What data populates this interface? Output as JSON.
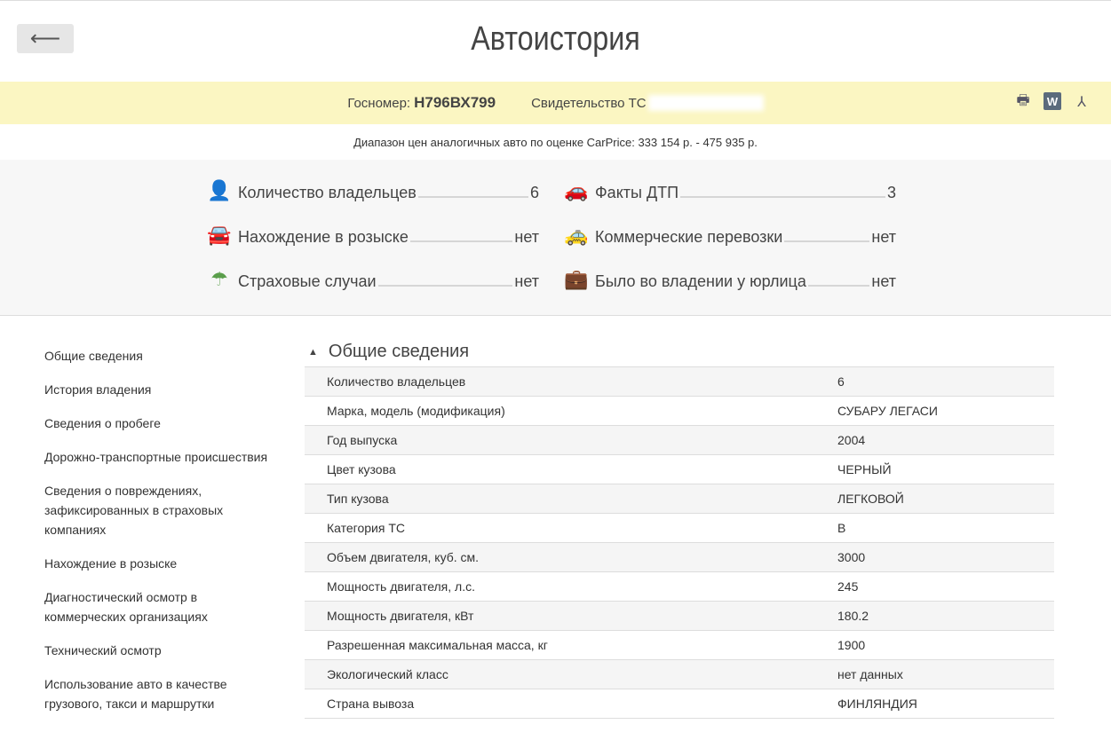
{
  "header": {
    "title": "Автоистория",
    "back_icon": "arrow-left"
  },
  "info": {
    "plate_label": "Госномер:",
    "plate": "Н796ВХ799",
    "cert_label": "Свидетельство ТС"
  },
  "price": "Диапазон цен аналогичных авто по оценке CarPrice: 333 154 р. - 475 935 р.",
  "summary": [
    {
      "label": "Количество владельцев",
      "value": "6",
      "icon": "person-icon"
    },
    {
      "label": "Факты ДТП",
      "value": "3",
      "icon": "crashed-car-icon"
    },
    {
      "label": "Нахождение в розыске",
      "value": "нет",
      "icon": "car-check-icon"
    },
    {
      "label": "Коммерческие перевозки",
      "value": "нет",
      "icon": "taxi-icon"
    },
    {
      "label": "Страховые случаи",
      "value": "нет",
      "icon": "umbrella-icon"
    },
    {
      "label": "Было во владении у юрлица",
      "value": "нет",
      "icon": "person-briefcase-icon"
    }
  ],
  "sidebar": [
    "Общие сведения",
    "История владения",
    "Сведения о пробеге",
    "Дорожно-транспортные происшествия",
    "Сведения о повреждениях, зафиксированных в страховых компаниях",
    "Нахождение в розыске",
    "Диагностический осмотр в коммерческих организациях",
    "Технический осмотр",
    "Использование авто в качестве грузового, такси и маршрутки"
  ],
  "section": {
    "title": "Общие сведения",
    "rows": [
      [
        "Количество владельцев",
        "6"
      ],
      [
        "Марка, модель (модификация)",
        "СУБАРУ ЛЕГАСИ"
      ],
      [
        "Год выпуска",
        "2004"
      ],
      [
        "Цвет кузова",
        "ЧЕРНЫЙ"
      ],
      [
        "Тип кузова",
        "ЛЕГКОВОЙ"
      ],
      [
        "Категория ТС",
        "B"
      ],
      [
        "Объем двигателя, куб. см.",
        "3000"
      ],
      [
        "Мощность двигателя, л.с.",
        "245"
      ],
      [
        "Мощность двигателя, кВт",
        "180.2"
      ],
      [
        "Разрешенная максимальная масса, кг",
        "1900"
      ],
      [
        "Экологический класс",
        "нет данных"
      ],
      [
        "Страна вывоза",
        "ФИНЛЯНДИЯ"
      ]
    ]
  }
}
